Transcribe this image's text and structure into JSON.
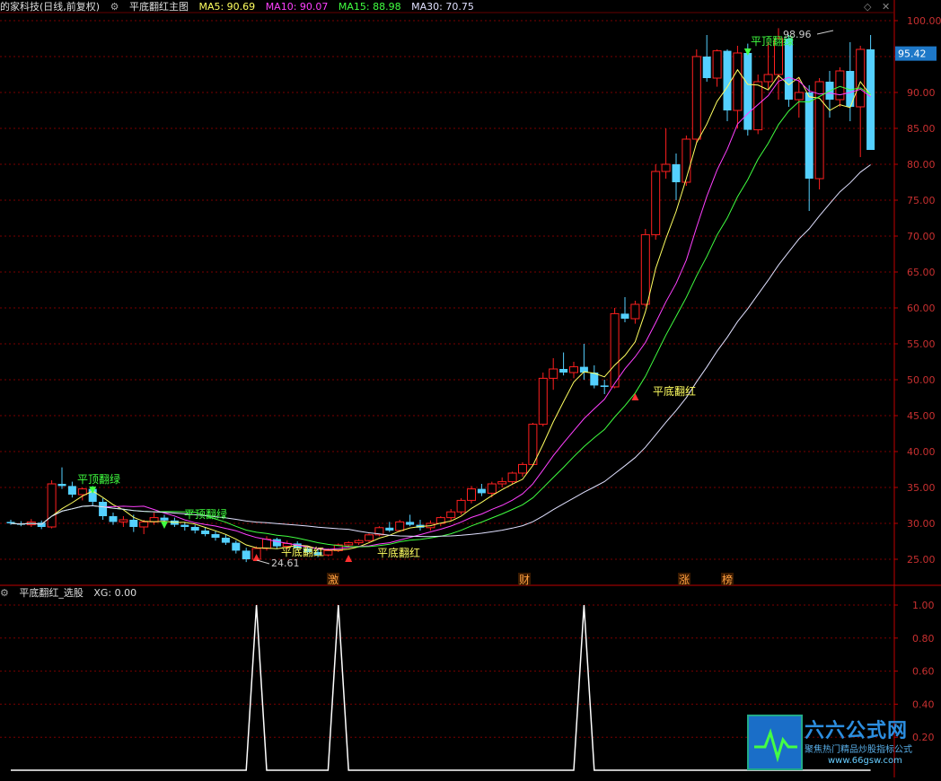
{
  "header": {
    "title": "的家科技(日线,前复权)",
    "indicator_name": "平底翻红主图",
    "ma": [
      {
        "label": "MA5: 90.69",
        "color": "#ffff60"
      },
      {
        "label": "MA10: 90.07",
        "color": "#ff40ff"
      },
      {
        "label": "MA15: 88.98",
        "color": "#40ff40"
      },
      {
        "label": "MA30: 70.75",
        "color": "#e0e0ff"
      }
    ]
  },
  "main_axis": {
    "ticks": [
      "100.00",
      "95.00",
      "90.00",
      "85.00",
      "80.00",
      "75.00",
      "70.00",
      "65.00",
      "60.00",
      "55.00",
      "50.00",
      "45.00",
      "40.00",
      "35.00",
      "30.00",
      "25.00"
    ],
    "current_price": "95.42"
  },
  "annotations": {
    "high": "98.96",
    "low": "24.61",
    "signals": [
      {
        "text": "平顶翻绿",
        "color": "#40ff40"
      },
      {
        "text": "平顶翻绿",
        "color": "#40ff40"
      },
      {
        "text": "平底翻红",
        "color": "#ffff60"
      },
      {
        "text": "平底翻红",
        "color": "#ffff60"
      },
      {
        "text": "平底翻红",
        "color": "#ffff60"
      },
      {
        "text": "平顶翻绿",
        "color": "#40ff40"
      }
    ],
    "markers": [
      "激",
      "财",
      "涨",
      "榜"
    ]
  },
  "sub_panel": {
    "title": "平底翻红_选股",
    "value_label": "XG: 0.00",
    "ticks": [
      "1.00",
      "0.80",
      "0.60",
      "0.40",
      "0.20"
    ]
  },
  "watermark": {
    "title": "六六公式网",
    "subtitle": "聚焦热门精品炒股指标公式",
    "url": "www.66gsw.com"
  },
  "chart_data": {
    "type": "candlestick",
    "candles": [
      [
        30.2,
        30.5,
        29.8,
        30.0
      ],
      [
        30.0,
        30.3,
        29.6,
        29.8
      ],
      [
        29.8,
        30.6,
        29.5,
        30.2
      ],
      [
        30.1,
        30.4,
        29.2,
        29.5
      ],
      [
        29.5,
        36.0,
        29.3,
        35.5
      ],
      [
        35.5,
        37.8,
        34.8,
        35.2
      ],
      [
        35.2,
        35.8,
        33.6,
        34.0
      ],
      [
        34.0,
        35.0,
        33.2,
        34.8
      ],
      [
        34.8,
        35.2,
        32.5,
        33.0
      ],
      [
        33.0,
        33.5,
        30.5,
        31.0
      ],
      [
        31.0,
        31.5,
        29.8,
        30.2
      ],
      [
        30.2,
        31.0,
        29.5,
        30.5
      ],
      [
        30.5,
        31.2,
        28.8,
        29.5
      ],
      [
        29.5,
        30.5,
        28.5,
        30.2
      ],
      [
        30.2,
        31.5,
        29.8,
        30.8
      ],
      [
        30.8,
        31.2,
        30.0,
        30.4
      ],
      [
        30.4,
        30.8,
        29.5,
        29.8
      ],
      [
        29.8,
        30.2,
        29.0,
        29.5
      ],
      [
        29.5,
        29.8,
        28.6,
        29.0
      ],
      [
        29.0,
        29.5,
        28.2,
        28.5
      ],
      [
        28.5,
        28.9,
        27.6,
        28.0
      ],
      [
        28.0,
        28.4,
        27.0,
        27.3
      ],
      [
        27.3,
        27.6,
        25.8,
        26.2
      ],
      [
        26.2,
        26.6,
        24.61,
        25.0
      ],
      [
        25.0,
        26.8,
        24.8,
        26.5
      ],
      [
        26.5,
        28.2,
        26.2,
        27.8
      ],
      [
        27.8,
        28.0,
        26.5,
        26.8
      ],
      [
        26.8,
        27.6,
        26.4,
        27.2
      ],
      [
        27.2,
        27.5,
        26.2,
        26.5
      ],
      [
        26.5,
        26.8,
        25.6,
        26.0
      ],
      [
        26.0,
        26.4,
        25.3,
        25.6
      ],
      [
        25.6,
        26.5,
        25.4,
        26.2
      ],
      [
        26.2,
        27.2,
        26.0,
        27.0
      ],
      [
        27.0,
        27.5,
        26.6,
        27.3
      ],
      [
        27.3,
        27.8,
        27.0,
        27.6
      ],
      [
        27.6,
        28.6,
        27.4,
        28.4
      ],
      [
        28.4,
        29.6,
        28.2,
        29.4
      ],
      [
        29.4,
        30.2,
        28.8,
        29.0
      ],
      [
        29.0,
        30.5,
        28.8,
        30.2
      ],
      [
        30.2,
        31.2,
        29.6,
        29.8
      ],
      [
        29.8,
        30.5,
        29.0,
        29.4
      ],
      [
        29.4,
        30.4,
        29.0,
        30.0
      ],
      [
        30.0,
        31.0,
        29.6,
        30.8
      ],
      [
        30.8,
        32.0,
        30.4,
        31.6
      ],
      [
        31.6,
        33.5,
        31.2,
        33.2
      ],
      [
        33.2,
        35.2,
        32.8,
        34.8
      ],
      [
        34.8,
        35.5,
        33.8,
        34.2
      ],
      [
        34.2,
        35.8,
        33.6,
        35.5
      ],
      [
        35.5,
        36.4,
        35.0,
        35.8
      ],
      [
        35.8,
        37.2,
        35.4,
        37.0
      ],
      [
        37.0,
        38.5,
        36.5,
        38.2
      ],
      [
        38.2,
        44.0,
        38.0,
        43.8
      ],
      [
        43.8,
        51.0,
        43.5,
        50.2
      ],
      [
        50.2,
        53.0,
        48.6,
        51.5
      ],
      [
        51.5,
        53.8,
        50.6,
        51.0
      ],
      [
        51.0,
        52.5,
        50.2,
        51.8
      ],
      [
        51.8,
        55.0,
        50.0,
        51.0
      ],
      [
        51.0,
        52.0,
        48.8,
        49.2
      ],
      [
        49.2,
        50.0,
        48.0,
        49.0
      ],
      [
        49.0,
        60.0,
        48.8,
        59.2
      ],
      [
        59.2,
        61.5,
        58.0,
        58.5
      ],
      [
        58.5,
        61.0,
        57.8,
        60.5
      ],
      [
        60.5,
        71.0,
        60.2,
        70.2
      ],
      [
        70.2,
        80.0,
        69.5,
        79.0
      ],
      [
        79.0,
        85.0,
        78.0,
        80.0
      ],
      [
        80.0,
        81.5,
        75.0,
        77.5
      ],
      [
        77.5,
        84.0,
        77.0,
        83.5
      ],
      [
        83.5,
        96.0,
        83.0,
        95.0
      ],
      [
        95.0,
        98.0,
        91.5,
        92.0
      ],
      [
        92.0,
        96.0,
        90.8,
        95.8
      ],
      [
        95.8,
        96.0,
        86.0,
        87.5
      ],
      [
        87.5,
        96.5,
        85.0,
        95.5
      ],
      [
        95.5,
        96.8,
        84.0,
        84.8
      ],
      [
        84.8,
        92.5,
        84.2,
        91.5
      ],
      [
        91.5,
        97.0,
        90.5,
        92.5
      ],
      [
        92.5,
        98.96,
        89.0,
        97.5
      ],
      [
        97.5,
        98.0,
        88.0,
        89.0
      ],
      [
        89.0,
        92.0,
        86.5,
        90.0
      ],
      [
        90.0,
        91.0,
        73.5,
        78.0
      ],
      [
        78.0,
        92.0,
        76.5,
        91.5
      ],
      [
        91.5,
        93.0,
        86.5,
        89.0
      ],
      [
        89.0,
        93.5,
        88.0,
        93.0
      ],
      [
        93.0,
        97.0,
        86.0,
        88.0
      ],
      [
        88.0,
        96.5,
        81.0,
        96.0
      ],
      [
        96.0,
        98.0,
        82.0,
        82.0
      ]
    ],
    "xg_signal_positions": [
      24,
      32,
      56
    ]
  }
}
